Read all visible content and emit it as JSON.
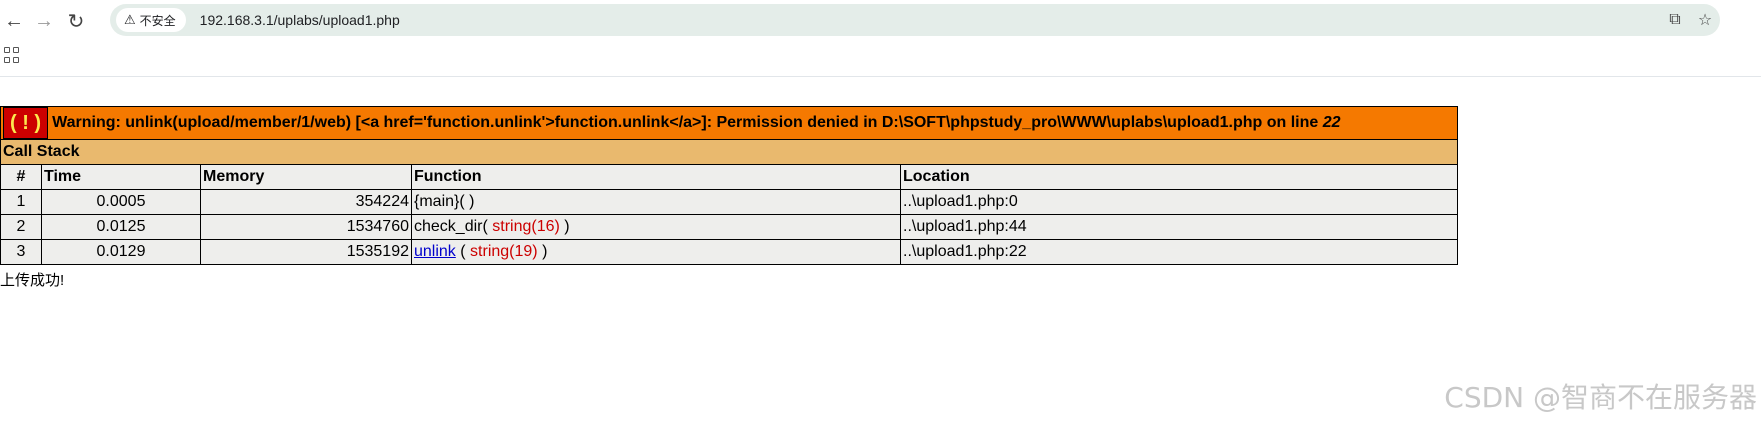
{
  "browser": {
    "security_label": "不安全",
    "url": "192.168.3.1/uplabs/upload1.php"
  },
  "error": {
    "badge": "( ! )",
    "message": "Warning: unlink(upload/member/1/web) [<a href='function.unlink'>function.unlink</a>]: Permission denied in D:\\SOFT\\phpstudy_pro\\WWW\\uplabs\\upload1.php on line ",
    "line": "22"
  },
  "call_stack": {
    "title": "Call Stack",
    "headers": {
      "num": "#",
      "time": "Time",
      "memory": "Memory",
      "function": "Function",
      "location": "Location"
    },
    "rows": [
      {
        "num": "1",
        "time": "0.0005",
        "memory": "354224",
        "func": "{main}( )",
        "location": "..\\upload1.php:0"
      },
      {
        "num": "2",
        "time": "0.0125",
        "memory": "1534760",
        "func": "check_dir(",
        "arg": "string(16)",
        "close": ")",
        "location": "..\\upload1.php:44"
      },
      {
        "num": "3",
        "time": "0.0129",
        "memory": "1535192",
        "func": "unlink",
        "open": "(",
        "arg": "string(19)",
        "close": ")",
        "location": "..\\upload1.php:22"
      }
    ]
  },
  "result_text": "上传成功!",
  "watermark": "CSDN @智商不在服务器"
}
